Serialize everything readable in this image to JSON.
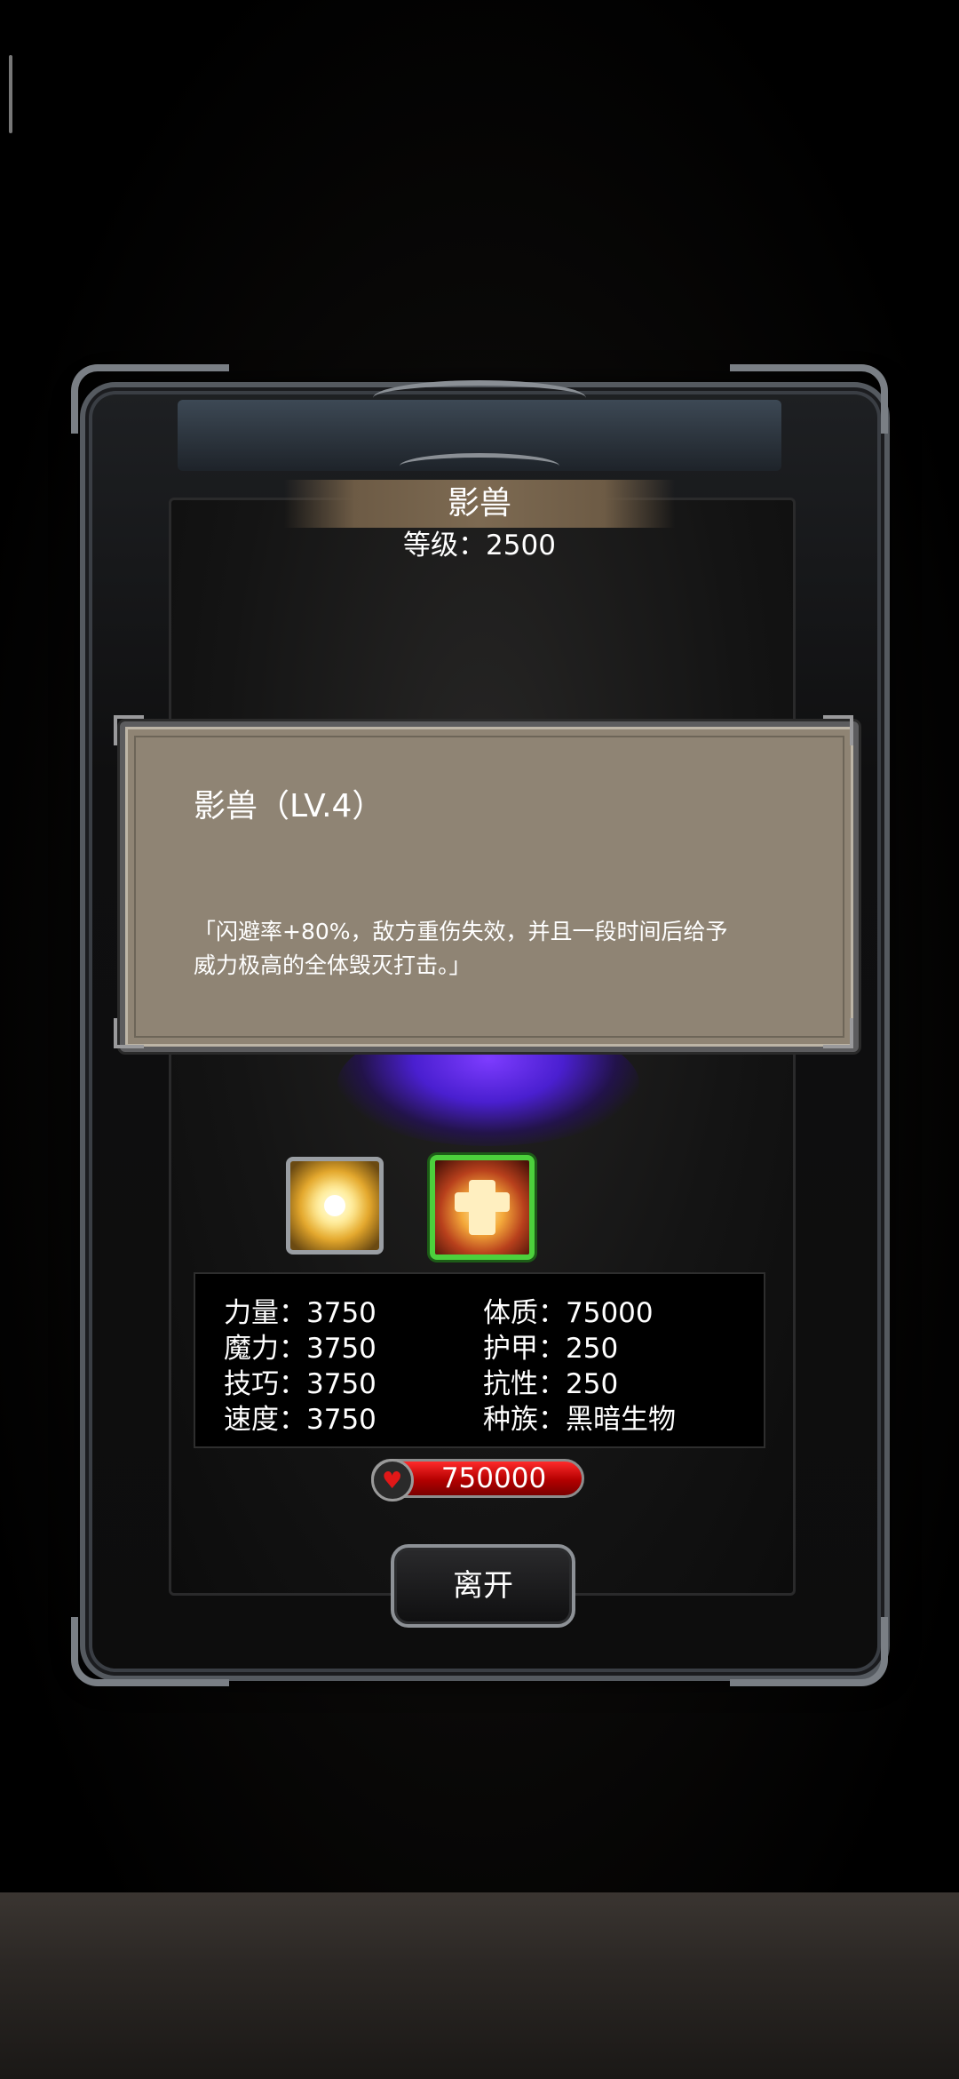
{
  "monster": {
    "name": "影兽",
    "level": "等级：2500"
  },
  "description": {
    "title": "影兽（LV.4）",
    "body_line1": "「闪避率+80%，敌方重伤失效，并且一段时间后给予",
    "body_line2": "威力极高的全体毁灭打击。」"
  },
  "skills": [
    {
      "icon": "golden-burst-icon",
      "selected": false
    },
    {
      "icon": "fire-shield-cross-icon",
      "selected": true
    }
  ],
  "stats": {
    "strength": "力量：3750",
    "magic": "魔力：3750",
    "skill": "技巧：3750",
    "speed": "速度：3750",
    "constitution": "体质：75000",
    "armor": "护甲：250",
    "resistance": "抗性：250",
    "race": "种族：黑暗生物"
  },
  "hp": {
    "icon": "heart-icon",
    "value": "750000"
  },
  "buttons": {
    "leave": "离开"
  },
  "colors": {
    "hp_bar": "#d40000",
    "selected_skill_border": "#4cd03c",
    "parchment": "#8f8474"
  }
}
